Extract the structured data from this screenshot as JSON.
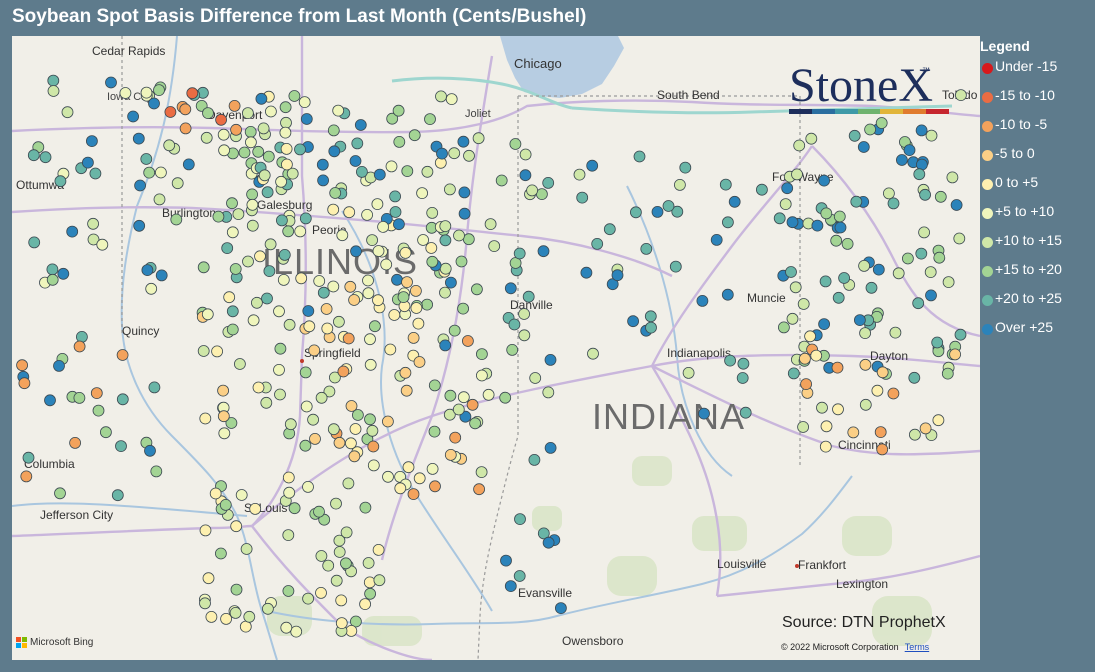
{
  "title": "Soybean Spot Basis Difference from Last Month (Cents/Bushel)",
  "legend": {
    "title": "Legend",
    "items": [
      {
        "label": "Under -15",
        "color": "#d7191c"
      },
      {
        "label": "-15 to -10",
        "color": "#ea6c43"
      },
      {
        "label": "-10 to -5",
        "color": "#f3a25c"
      },
      {
        "label": "-5 to 0",
        "color": "#fbcf86"
      },
      {
        "label": "0 to +5",
        "color": "#fdf0b0"
      },
      {
        "label": "+5 to +10",
        "color": "#eff5bc"
      },
      {
        "label": "+10 to +15",
        "color": "#cfe7a8"
      },
      {
        "label": "+15 to +20",
        "color": "#a3d494"
      },
      {
        "label": "+20 to +25",
        "color": "#69b5a6"
      },
      {
        "label": "Over +25",
        "color": "#2b83ba"
      }
    ]
  },
  "states": {
    "illinois": "ILLINOIS",
    "indiana": "INDIANA"
  },
  "cities": {
    "cedar_rapids": "Cedar Rapids",
    "iowa_city": "Iowa City",
    "davenport": "Davenport",
    "ottumwa": "Ottumwa",
    "burlington": "Burlington",
    "galesburg": "Galesburg",
    "peoria": "Peoria",
    "quincy": "Quincy",
    "springfield": "Springfield",
    "columbia": "Columbia",
    "jefferson_city": "Jefferson City",
    "st_louis": "St Louis",
    "chicago": "Chicago",
    "joliet": "Joliet",
    "south_bend": "South Bend",
    "fort_wayne": "Fort Wayne",
    "danville": "Danville",
    "muncie": "Muncie",
    "indianapolis": "Indianapolis",
    "dayton": "Dayton",
    "cincinnati": "Cincinnati",
    "louisville": "Louisville",
    "frankfort": "Frankfort",
    "lexington": "Lexington",
    "evansville": "Evansville",
    "owensboro": "Owensboro",
    "toledo": "Toledo"
  },
  "logo": {
    "name": "StoneX",
    "tm": "™",
    "bar_colors": [
      "#1d2e5c",
      "#2b6ea0",
      "#3f9aa8",
      "#6fb36f",
      "#e1b53a",
      "#e07b2e",
      "#c6262e"
    ]
  },
  "source": "Source: DTN ProphetX",
  "copyright": "© 2022 Microsoft Corporation",
  "terms": "Terms",
  "bing": "Microsoft Bing",
  "bing_colors": [
    "#f25022",
    "#7fba00",
    "#00a4ef",
    "#ffb900"
  ]
}
